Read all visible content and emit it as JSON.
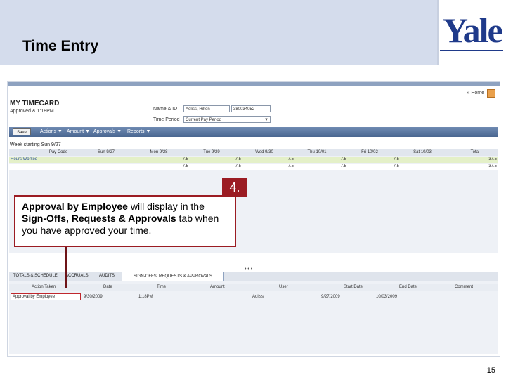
{
  "slide": {
    "title": "Time Entry",
    "logo": "Yale",
    "page_number": "15"
  },
  "timecard": {
    "home_link": "« Home",
    "title": "MY TIMECARD",
    "approved_text": "Approved & 1:18PM",
    "name_label": "Name & ID",
    "name_value": "Aoliss, Hilton",
    "id_value": "380034052",
    "period_label": "Time Period",
    "period_value": "Current Pay Period",
    "toolbar": {
      "save": "Save",
      "actions": "Actions ▼",
      "amount": "Amount ▼",
      "approvals": "Approvals ▼",
      "reports": "Reports ▼"
    },
    "week_label": "Week starting Sun 9/27",
    "grid": {
      "headers": [
        "Pay Code",
        "Sun 9/27",
        "Mon 9/28",
        "Tue 9/29",
        "Wed 9/30",
        "Thu 10/01",
        "Fri 10/02",
        "Sat 10/03",
        "Total"
      ],
      "rows": [
        [
          "Hours Worked",
          "",
          "7.5",
          "7.5",
          "7.5",
          "7.5",
          "7.5",
          "",
          "37.5"
        ],
        [
          "",
          "",
          "7.5",
          "7.5",
          "7.5",
          "7.5",
          "7.5",
          "",
          "37.5"
        ]
      ]
    },
    "tabs": [
      "TOTALS & SCHEDULE",
      "ACCRUALS",
      "AUDITS",
      "SIGN-OFFS, REQUESTS & APPROVALS"
    ],
    "signoff_headers": [
      "Action Taken",
      "Date",
      "Time",
      "Amount",
      "User",
      "Start Date",
      "End Date",
      "Comment"
    ],
    "signoff_row": [
      "Approval by Employee",
      "9/30/2009",
      "1:18PM",
      "",
      "Aoliss",
      "9/27/2009",
      "10/03/2009",
      ""
    ]
  },
  "callout": {
    "step": "4.",
    "bold1": "Approval by Employee",
    "text1": " will display in the ",
    "bold2": "Sign-Offs, Requests & Approvals",
    "text2": " tab when you have approved your time."
  },
  "colors": {
    "header_bg": "#d4dcec",
    "accent_red": "#9b1c23",
    "yale_blue": "#1f3a8a"
  }
}
